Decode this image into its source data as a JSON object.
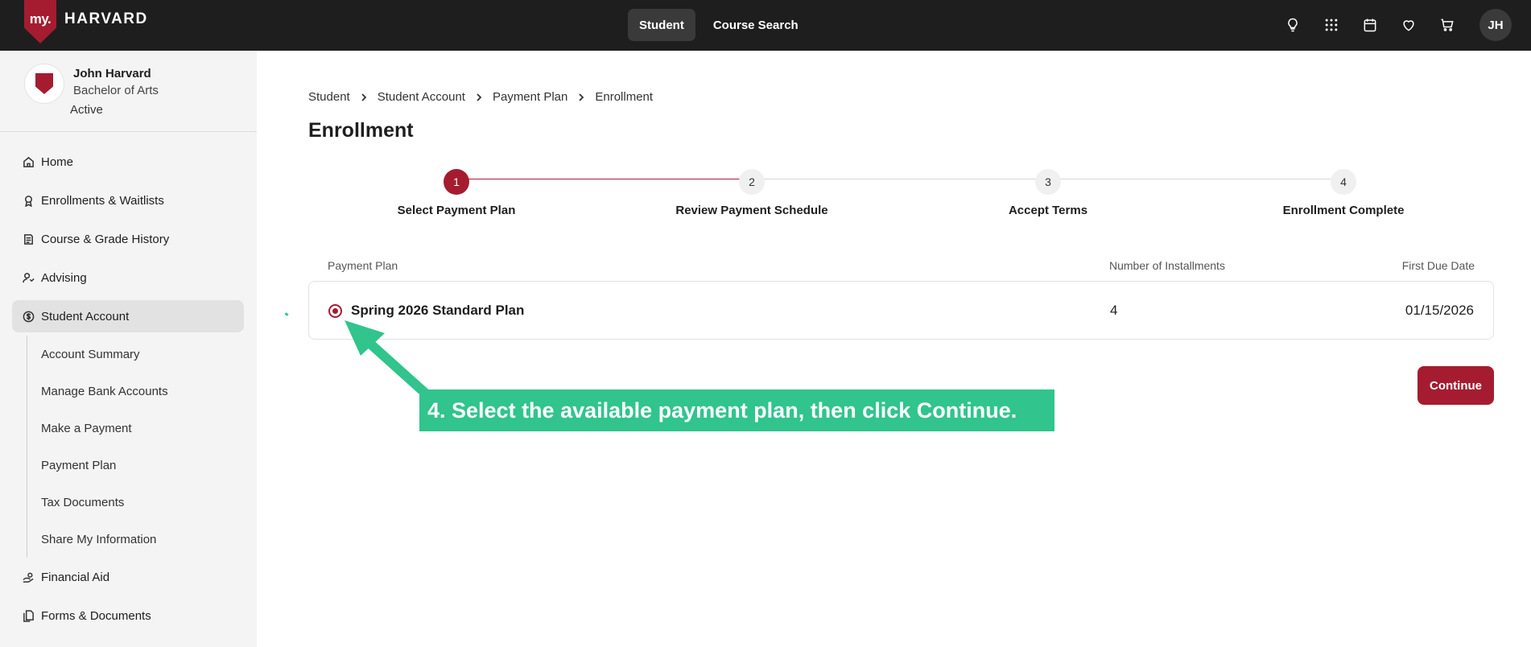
{
  "brand": {
    "shield_text": "my.",
    "name": "HARVARD",
    "accent": "#a51c30"
  },
  "topnav": [
    {
      "label": "Student",
      "active": true
    },
    {
      "label": "Course Search",
      "active": false
    }
  ],
  "top_icons": [
    "lightbulb-icon",
    "apps-grid-icon",
    "calendar-icon",
    "heart-icon",
    "cart-icon"
  ],
  "user": {
    "initials": "JH",
    "name": "John Harvard",
    "degree": "Bachelor of Arts",
    "status": "Active"
  },
  "sidebar": {
    "items": [
      {
        "label": "Home",
        "icon": "home-icon"
      },
      {
        "label": "Enrollments & Waitlists",
        "icon": "ribbon-icon"
      },
      {
        "label": "Course & Grade History",
        "icon": "history-icon"
      },
      {
        "label": "Advising",
        "icon": "advisor-icon"
      },
      {
        "label": "Student Account",
        "icon": "dollar-icon",
        "active": true
      },
      {
        "label": "Financial Aid",
        "icon": "hand-coin-icon"
      },
      {
        "label": "Forms & Documents",
        "icon": "documents-icon"
      }
    ],
    "sub_items": [
      "Account Summary",
      "Manage Bank Accounts",
      "Make a Payment",
      "Payment Plan",
      "Tax Documents",
      "Share My Information"
    ]
  },
  "breadcrumb": [
    "Student",
    "Student Account",
    "Payment Plan",
    "Enrollment"
  ],
  "page_title": "Enrollment",
  "steps": [
    {
      "number": "1",
      "label": "Select Payment Plan",
      "current": true
    },
    {
      "number": "2",
      "label": "Review Payment Schedule",
      "current": false
    },
    {
      "number": "3",
      "label": "Accept Terms",
      "current": false
    },
    {
      "number": "4",
      "label": "Enrollment Complete",
      "current": false
    }
  ],
  "table": {
    "headers": {
      "plan": "Payment Plan",
      "installments": "Number of Installments",
      "due": "First Due Date"
    },
    "rows": [
      {
        "plan": "Spring 2026 Standard Plan",
        "installments": "4",
        "due": "01/15/2026",
        "selected": true
      }
    ]
  },
  "continue_label": "Continue",
  "annotation": {
    "text": "4. Select the available payment plan, then click Continue.",
    "color": "#31c48d"
  }
}
